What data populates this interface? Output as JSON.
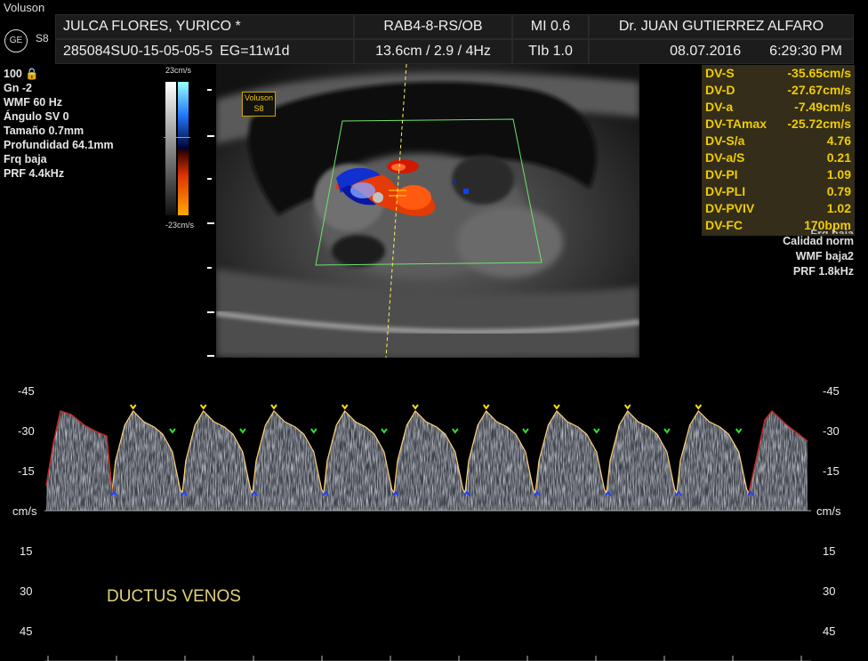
{
  "header": {
    "brand": "Voluson",
    "model": "S8",
    "ge_logo_text": "GE",
    "patient_name": "JULCA FLORES, YURICO *",
    "patient_id": "285084SU0-15-05-05-5",
    "gestational_age": "EG=11w1d",
    "probe": "RAB4-8-RS/OB",
    "imaging_params": "13.6cm / 2.9 /  4Hz",
    "mi": "MI  0.6",
    "tib": "TIb  1.0",
    "doctor": "Dr. JUAN GUTIERREZ ALFARO",
    "date": "08.07.2016",
    "time": "6:29:30 PM"
  },
  "left_params": [
    "100 🔒",
    "Gn  -2",
    "WMF 60 Hz",
    "Ángulo SV  0",
    "Tamaño  0.7mm",
    "Profundidad 64.1mm",
    "Frq baja",
    "PRF  4.4kHz"
  ],
  "color_bar": {
    "top": "23cm/s",
    "bottom": "-23cm/s"
  },
  "voluson_tag": {
    "line1": "Voluson",
    "line2": "S8"
  },
  "measurements": [
    {
      "label": "DV-S",
      "value": "-35.65cm/s"
    },
    {
      "label": "DV-D",
      "value": "-27.67cm/s"
    },
    {
      "label": "DV-a",
      "value": "-7.49cm/s"
    },
    {
      "label": "DV-TAmax",
      "value": "-25.72cm/s"
    },
    {
      "label": "DV-S/a",
      "value": "4.76"
    },
    {
      "label": "DV-a/S",
      "value": "0.21"
    },
    {
      "label": "DV-PI",
      "value": "1.09"
    },
    {
      "label": "DV-PLI",
      "value": "0.79"
    },
    {
      "label": "DV-PVIV",
      "value": "1.02"
    },
    {
      "label": "DV-FC",
      "value": "170bpm"
    }
  ],
  "doppler_params": [
    "Frq baja",
    "Calidad norm",
    "WMF baja2",
    "PRF  1.8kHz"
  ],
  "spectral": {
    "scale_labels": [
      "-45",
      "-30",
      "-15",
      "cm/s",
      "15",
      "30",
      "45"
    ],
    "annotation": "DUCTUS VENOS",
    "colors": {
      "trace": "#ffd27a",
      "edge_trace": "#c02020",
      "s_marker": "#ffe000",
      "d_marker": "#30e030",
      "a_marker": "#2040ff"
    }
  }
}
